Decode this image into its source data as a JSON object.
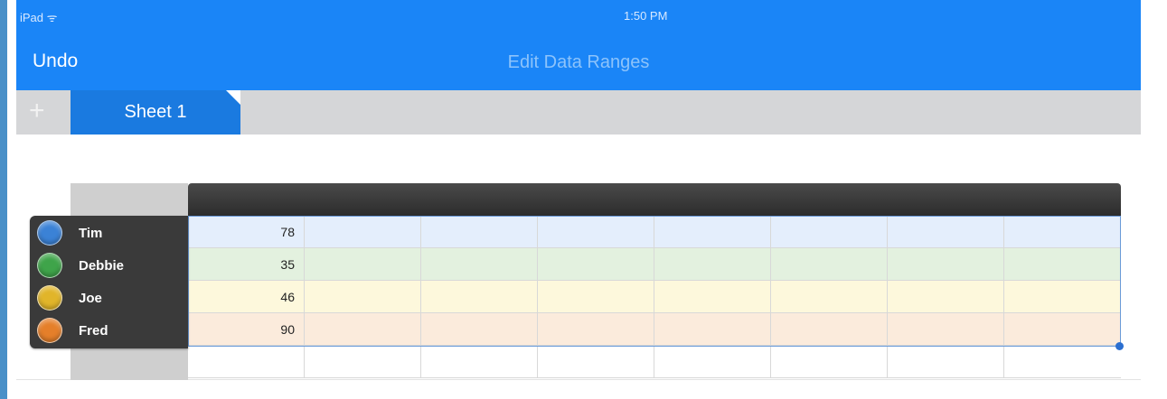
{
  "status_bar": {
    "carrier": "iPad ᯤ",
    "time": "1:50 PM"
  },
  "nav": {
    "undo_label": "Undo",
    "title": "Edit Data Ranges"
  },
  "tabs": {
    "add_label": "+",
    "sheet_label": "Sheet 1"
  },
  "series": [
    {
      "name": "Tim",
      "value": "78",
      "color": "#3b82d6",
      "row_color": "#e4eefc"
    },
    {
      "name": "Debbie",
      "value": "35",
      "color": "#3fa44a",
      "row_color": "#e3f1df"
    },
    {
      "name": "Joe",
      "value": "46",
      "color": "#e1b52a",
      "row_color": "#fdf8dc"
    },
    {
      "name": "Fred",
      "value": "90",
      "color": "#e57f2a",
      "row_color": "#fbebdc"
    }
  ],
  "colors": {
    "nav_blue": "#1a85f7",
    "tab_blue": "#1a7ae0",
    "tabbar_gray": "#d5d6d8"
  }
}
